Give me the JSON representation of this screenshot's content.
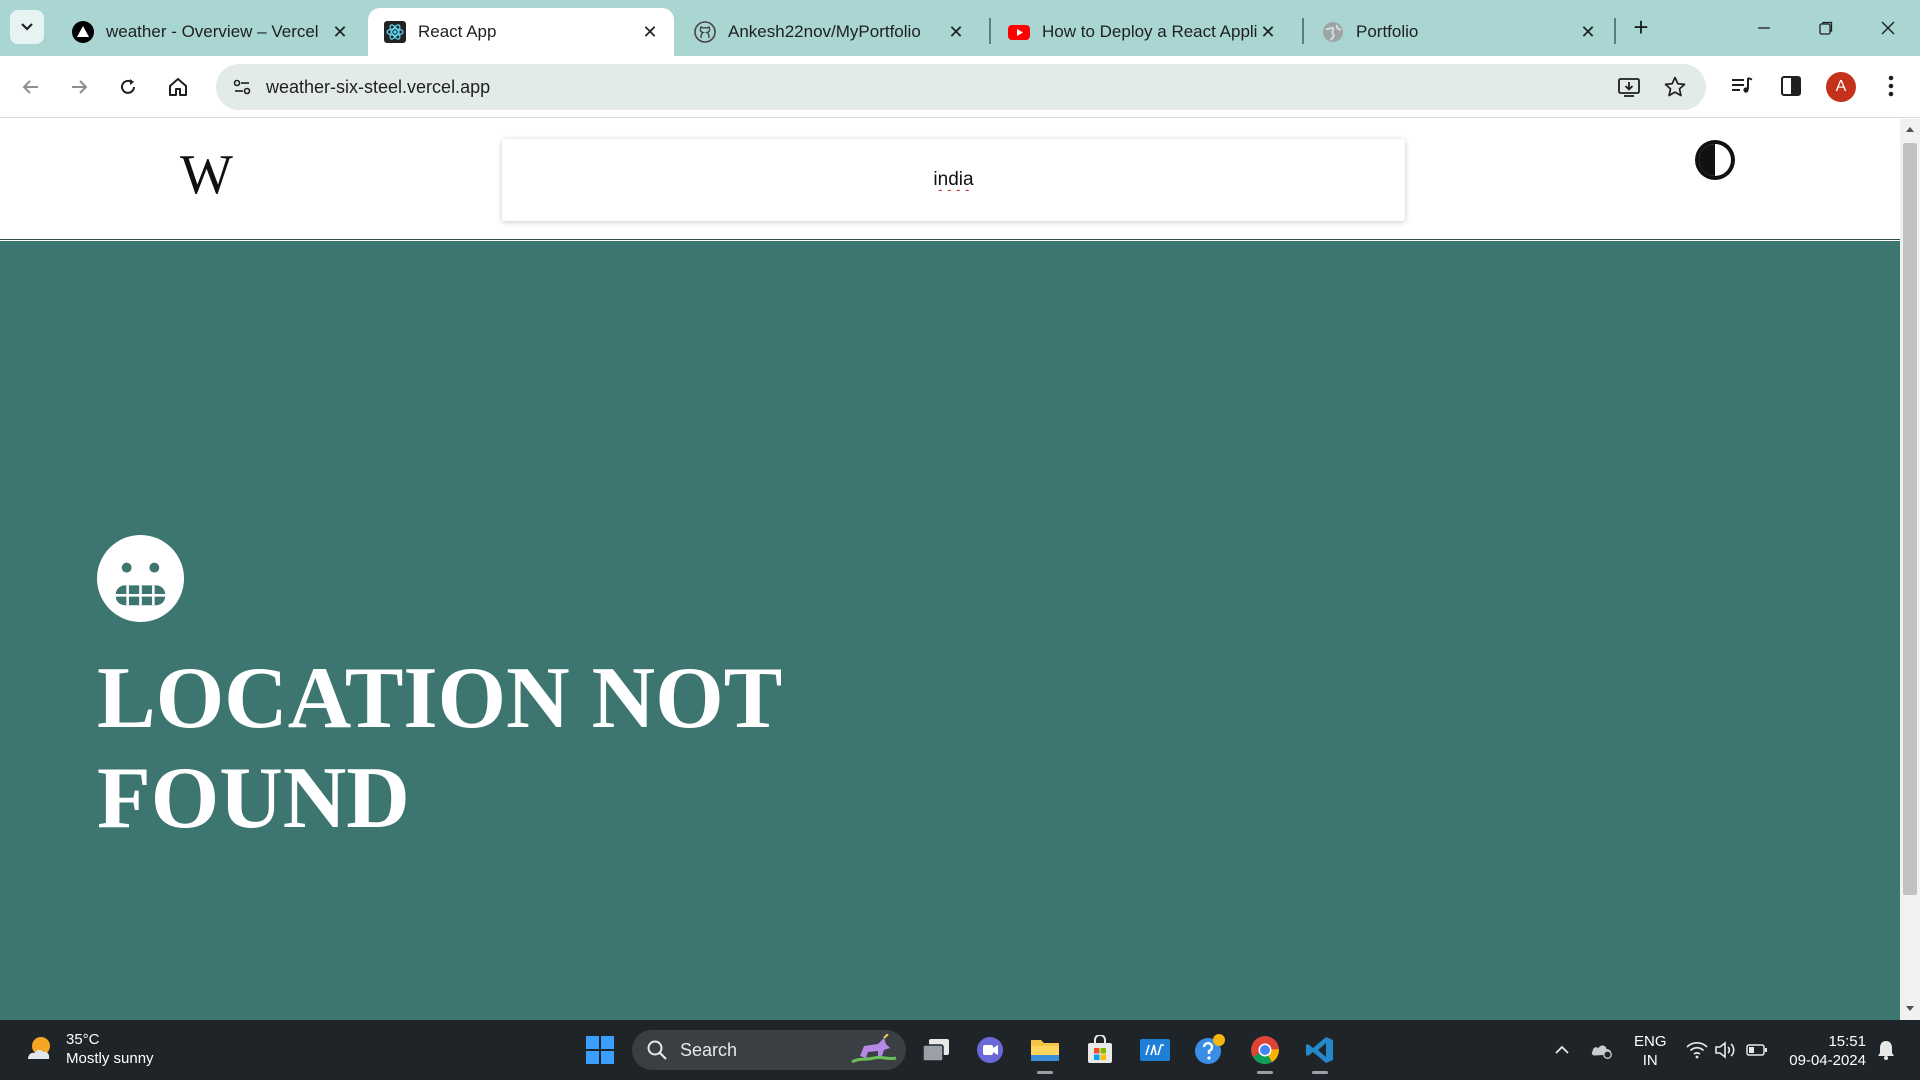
{
  "browser": {
    "tabs": [
      {
        "title": "weather - Overview – Vercel",
        "icon": "vercel-icon",
        "active": false
      },
      {
        "title": "React App",
        "icon": "react-icon",
        "active": true
      },
      {
        "title": "Ankesh22nov/MyPortfolio",
        "icon": "github-icon",
        "active": false
      },
      {
        "title": "How to Deploy a React Applic",
        "icon": "youtube-icon",
        "active": false
      },
      {
        "title": "Portfolio",
        "icon": "globe-icon",
        "active": false
      }
    ],
    "close_glyph": "✕",
    "new_tab_glyph": "+",
    "address": "weather-six-steel.vercel.app",
    "profile_initial": "A"
  },
  "app": {
    "logo": "W",
    "search": {
      "value": "india"
    },
    "error": {
      "message": "LOCATION NOT FOUND",
      "icon": "grimacing-face-icon"
    }
  },
  "taskbar": {
    "weather": {
      "temp": "35°C",
      "condition": "Mostly sunny"
    },
    "search_label": "Search",
    "language": {
      "lang": "ENG",
      "region": "IN"
    },
    "clock": {
      "time": "15:51",
      "date": "09-04-2024"
    }
  },
  "colors": {
    "tab_strip": "#a9d6d3",
    "main_bg": "#3d7670",
    "taskbar_bg": "#1f2428",
    "profile": "#c5321b"
  }
}
